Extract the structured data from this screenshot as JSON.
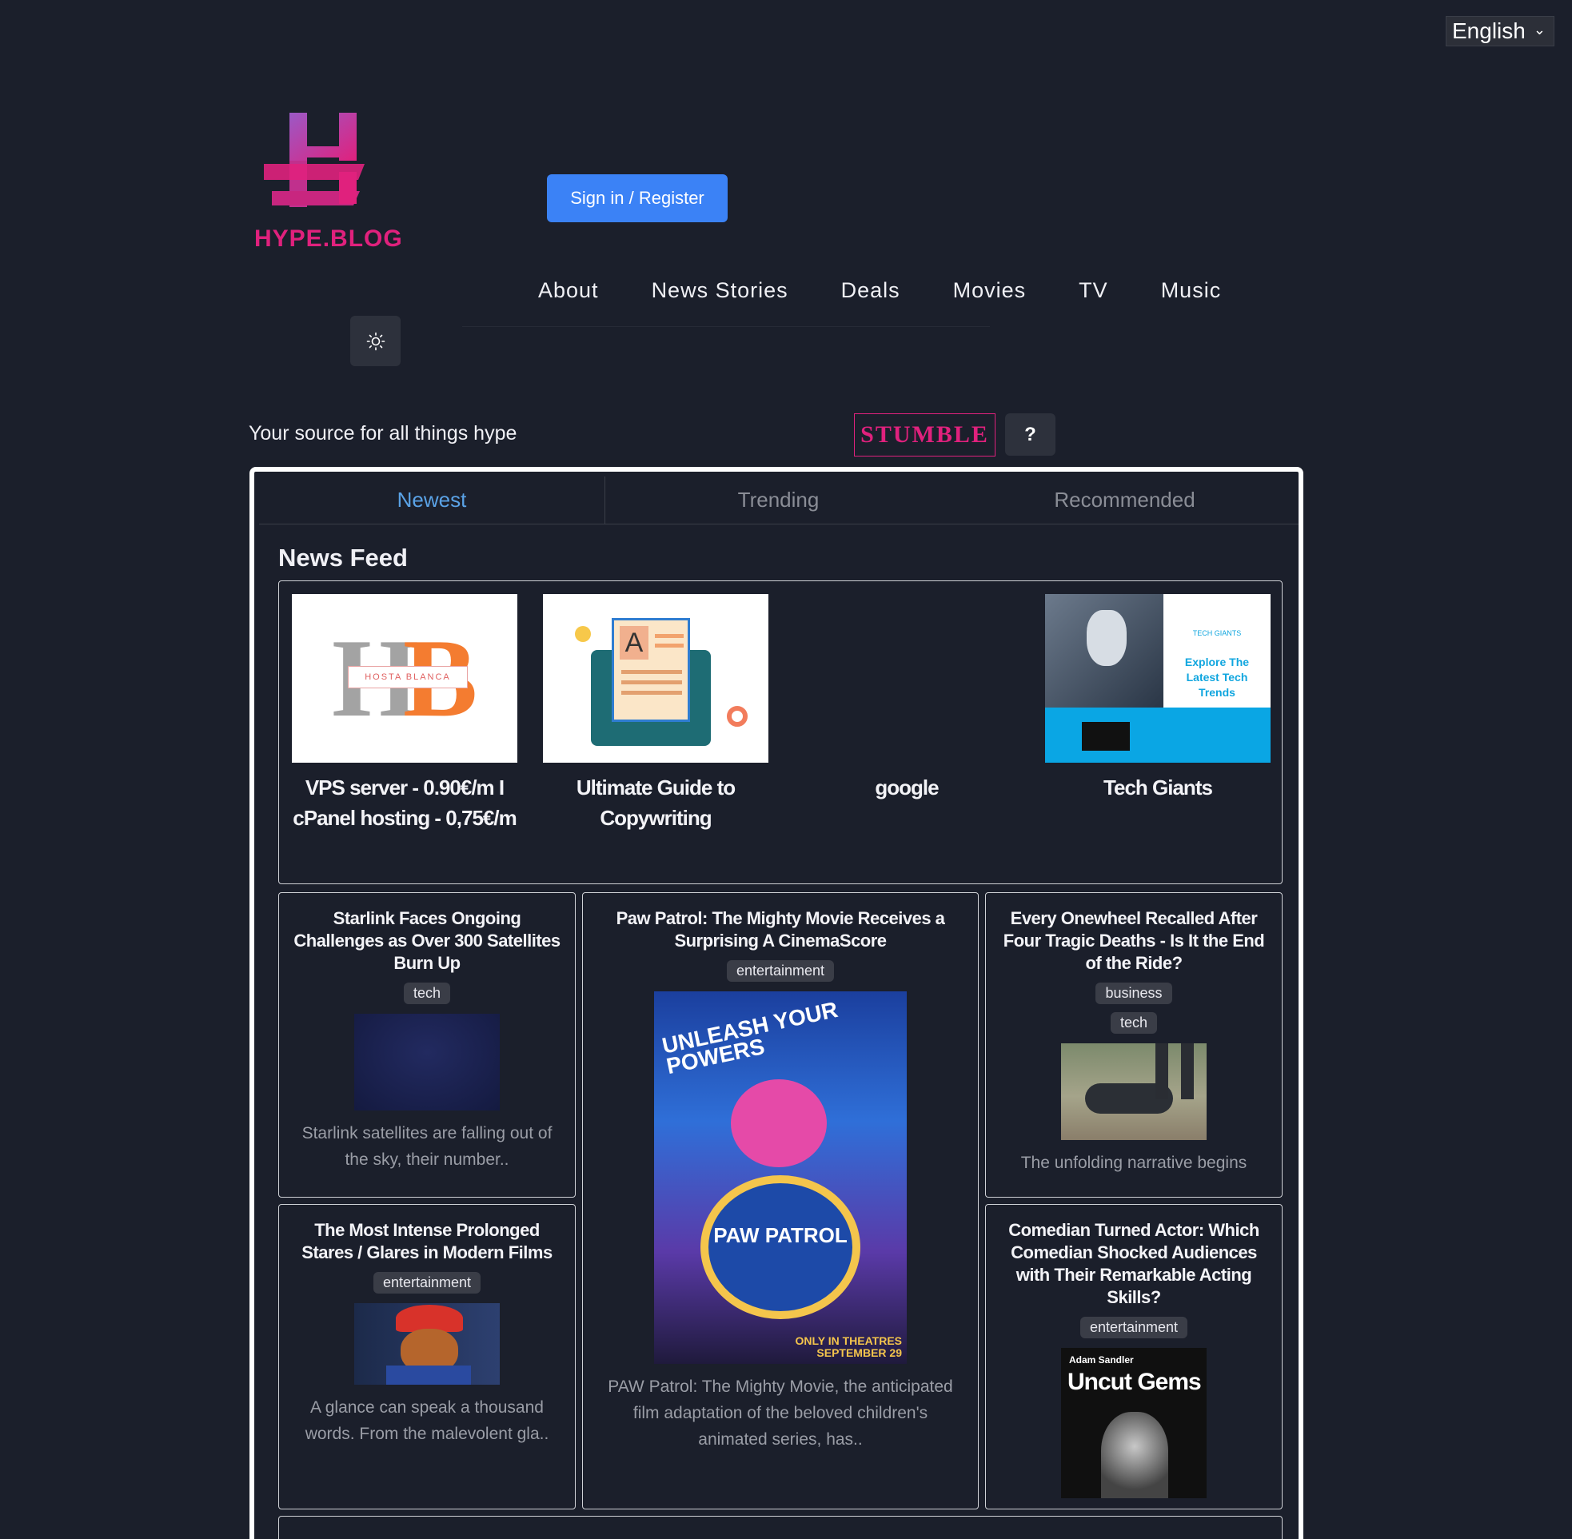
{
  "language": {
    "selected": "English"
  },
  "brand": {
    "name": "HYPE.BLOG"
  },
  "auth": {
    "signin_label": "Sign in / Register"
  },
  "nav": {
    "items": [
      "About",
      "News Stories",
      "Deals",
      "Movies",
      "TV",
      "Music"
    ]
  },
  "tagline": "Your source for all things hype",
  "stumble": {
    "label": "STUMBLE",
    "help": "?"
  },
  "tabs": [
    "Newest",
    "Trending",
    "Recommended"
  ],
  "feed": {
    "title": "News Feed",
    "promos": [
      {
        "title": "VPS server - 0.90€/m I cPanel hosting - 0,75€/m",
        "image_text": "HOSTA BLANCA"
      },
      {
        "title": "Ultimate Guide to Copywriting",
        "image_text": "A"
      },
      {
        "title": "google"
      },
      {
        "title": "Tech Giants",
        "image_text": "TECH GIANTS",
        "image_caption": "Explore The Latest Tech Trends"
      }
    ],
    "articles": [
      {
        "title": "Starlink Faces Ongoing Challenges as Over 300 Satellites Burn Up",
        "tags": [
          "tech"
        ],
        "desc": "Starlink satellites are falling out of the sky, their number.."
      },
      {
        "title": "Paw Patrol: The Mighty Movie Receives a Surprising A CinemaScore",
        "tags": [
          "entertainment"
        ],
        "desc": "PAW Patrol: The Mighty Movie, the anticipated film adaptation of the beloved children's animated series, has..",
        "poster_top": "UNLEASH YOUR POWERS",
        "poster_logo": "PAW PATROL",
        "poster_date": "ONLY IN THEATRES SEPTEMBER 29"
      },
      {
        "title": "Every Onewheel Recalled After Four Tragic Deaths - Is It the End of the Ride?",
        "tags": [
          "business",
          "tech"
        ],
        "desc": "The unfolding narrative begins"
      },
      {
        "title": "The Most Intense Prolonged Stares / Glares in Modern Films",
        "tags": [
          "entertainment"
        ],
        "desc": "A glance can speak a thousand words. From the malevolent gla.."
      },
      {
        "title": "Comedian Turned Actor: Which Comedian Shocked Audiences with Their Remarkable Acting Skills?",
        "tags": [
          "entertainment"
        ],
        "poster_actor": "Adam Sandler",
        "poster_title": "Uncut Gems"
      }
    ]
  },
  "colors": {
    "background": "#1b1f2b",
    "brand": "#e0217d",
    "accent": "#3b82f6",
    "active_tab": "#5aa2e6"
  }
}
